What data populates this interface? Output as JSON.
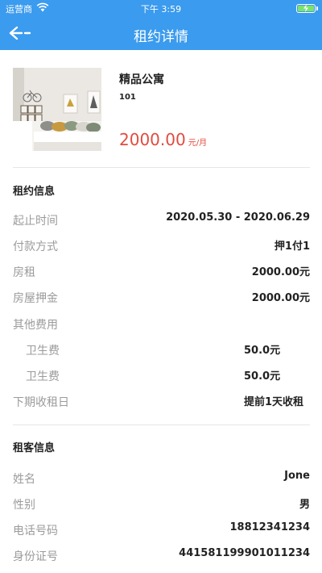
{
  "status_bar": {
    "carrier": "运营商",
    "time": "下午 3:59"
  },
  "nav": {
    "title": "租约详情",
    "back_icon": "back-arrow-icon"
  },
  "property": {
    "name": "精品公寓",
    "room": "101",
    "price": "2000.00",
    "price_unit": "元/月"
  },
  "lease_info": {
    "title": "租约信息",
    "rows": [
      {
        "label": "起止时间",
        "value": "2020.05.30 - 2020.06.29"
      },
      {
        "label": "付款方式",
        "value": "押1付1"
      },
      {
        "label": "房租",
        "value": "2000.00元"
      },
      {
        "label": "房屋押金",
        "value": "2000.00元"
      },
      {
        "label": "其他费用",
        "value": ""
      },
      {
        "label": "卫生费",
        "value": "50.0元"
      },
      {
        "label": "卫生费",
        "value": "50.0元"
      },
      {
        "label": "下期收租日",
        "value": "提前1天收租"
      }
    ]
  },
  "tenant_info": {
    "title": "租客信息",
    "rows": [
      {
        "label": "姓名",
        "value": "Jone"
      },
      {
        "label": "性别",
        "value": "男"
      },
      {
        "label": "电话号码",
        "value": "18812341234"
      },
      {
        "label": "身份证号",
        "value": "441581199901011234"
      }
    ]
  },
  "colors": {
    "header": "#3b9bee",
    "price": "#e24b3f",
    "label": "#9b9b9b"
  }
}
